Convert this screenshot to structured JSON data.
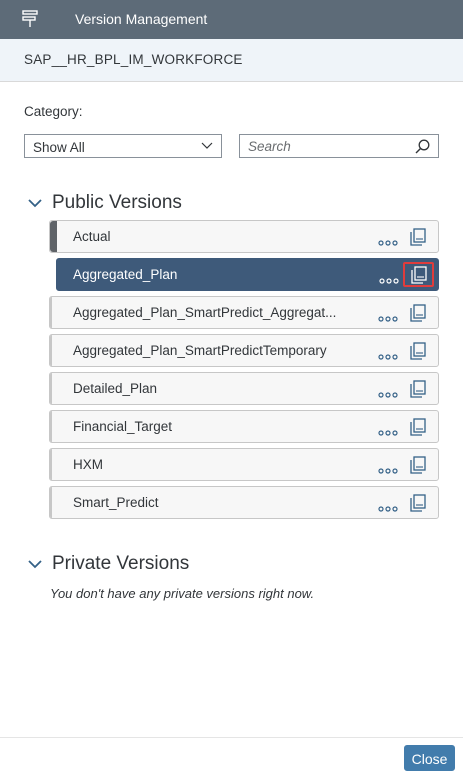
{
  "header": {
    "title": "Version Management",
    "icon": "signpost-icon",
    "color": "#5d6b78"
  },
  "model": {
    "name": "SAP__HR_BPL_IM_WORKFORCE"
  },
  "filter": {
    "category_label": "Category:",
    "category_value": "Show All",
    "search_placeholder": "Search"
  },
  "public_versions": {
    "title": "Public Versions",
    "items": [
      {
        "label": "Actual"
      },
      {
        "label": "Aggregated_Plan",
        "selected": true
      },
      {
        "label": "Aggregated_Plan_SmartPredict_Aggregat..."
      },
      {
        "label": "Aggregated_Plan_SmartPredictTemporary"
      },
      {
        "label": "Detailed_Plan"
      },
      {
        "label": "Financial_Target"
      },
      {
        "label": "HXM"
      },
      {
        "label": "Smart_Predict"
      }
    ]
  },
  "private_versions": {
    "title": "Private Versions",
    "empty_text": "You don't have any private versions right now."
  },
  "footer": {
    "close_label": "Close",
    "accent": "#427cac"
  },
  "colors": {
    "selected_row": "#3e5a7a",
    "highlight": "#e03c3c"
  }
}
